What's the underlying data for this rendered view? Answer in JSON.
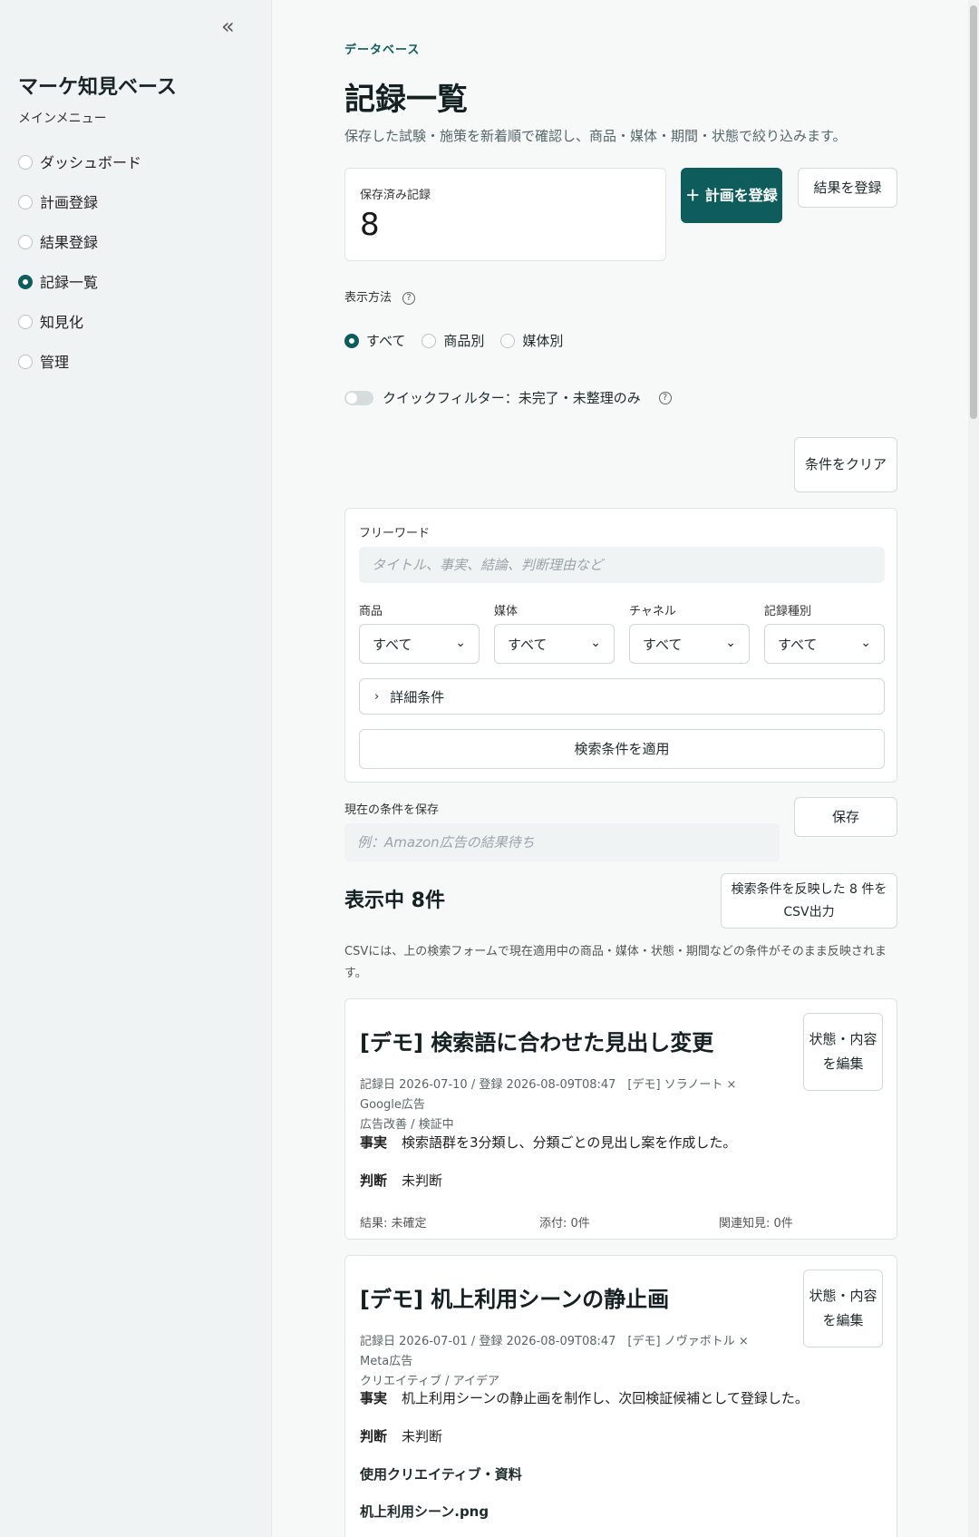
{
  "sidebar": {
    "collapse_icon": "«",
    "app_title": "マーケ知見ベース",
    "menu_title": "メインメニュー",
    "items": [
      {
        "label": "ダッシュボード",
        "active": false
      },
      {
        "label": "計画登録",
        "active": false
      },
      {
        "label": "結果登録",
        "active": false
      },
      {
        "label": "記録一覧",
        "active": true
      },
      {
        "label": "知見化",
        "active": false
      },
      {
        "label": "管理",
        "active": false
      }
    ]
  },
  "header": {
    "breadcrumb": "データベース",
    "title": "記録一覧",
    "description": "保存した試験・施策を新着順で確認し、商品・媒体・期間・状態で絞り込みます。"
  },
  "stats": {
    "label": "保存済み記録",
    "value": "8"
  },
  "actions": {
    "add_plan": "＋ 計画を登録",
    "add_result": "結果を登録"
  },
  "view": {
    "label": "表示方法",
    "options": [
      {
        "label": "すべて",
        "selected": true
      },
      {
        "label": "商品別",
        "selected": false
      },
      {
        "label": "媒体別",
        "selected": false
      }
    ]
  },
  "quick_filter": {
    "label": "クイックフィルター：未完了・未整理のみ",
    "on": false
  },
  "clear_button": "条件をクリア",
  "filters": {
    "freeword_label": "フリーワード",
    "freeword_placeholder": "タイトル、事実、結論、判断理由など",
    "selects": [
      {
        "label": "商品",
        "value": "すべて"
      },
      {
        "label": "媒体",
        "value": "すべて"
      },
      {
        "label": "チャネル",
        "value": "すべて"
      },
      {
        "label": "記録種別",
        "value": "すべて"
      }
    ],
    "advanced_label": "詳細条件",
    "apply_label": "検索条件を適用"
  },
  "save_condition": {
    "label": "現在の条件を保存",
    "placeholder": "例：Amazon広告の結果待ち",
    "button": "保存"
  },
  "results": {
    "heading": "表示中 8件",
    "csv_button": "検索条件を反映した 8 件をCSV出力",
    "csv_note": "CSVには、上の検索フォームで現在適用中の商品・媒体・状態・期間などの条件がそのまま反映されます。"
  },
  "cards": [
    {
      "title": "[デモ] 検索語に合わせた見出し変更",
      "meta_line1": "記録日 2026-07-10 / 登録 2026-08-09T08:47　[デモ] ソラノート × Google広告",
      "meta_line2": "広告改善 / 検証中",
      "fact_key": "事実",
      "fact": "検索語群を3分類し、分類ごとの見出し案を作成した。",
      "judge_key": "判断",
      "judge": "未判断",
      "result": "結果: 未確定",
      "attach": "添付: 0件",
      "related": "関連知見: 0件",
      "edit_label": "状態・内容を編集"
    },
    {
      "title": "[デモ] 机上利用シーンの静止画",
      "meta_line1": "記録日 2026-07-01 / 登録 2026-08-09T08:47　[デモ] ノヴァボトル × Meta広告",
      "meta_line2": "クリエイティブ / アイデア",
      "fact_key": "事実",
      "fact": "机上利用シーンの静止画を制作し、次回検証候補として登録した。",
      "judge_key": "判断",
      "judge": "未判断",
      "creative_heading": "使用クリエイティブ・資料",
      "file_name": "机上利用シーン.png",
      "edit_label": "状態・内容を編集"
    }
  ],
  "icons": {
    "chevron_down": "⌄",
    "chevron_right": "›",
    "help": "?"
  },
  "colors": {
    "accent": "#0f5c5c"
  }
}
